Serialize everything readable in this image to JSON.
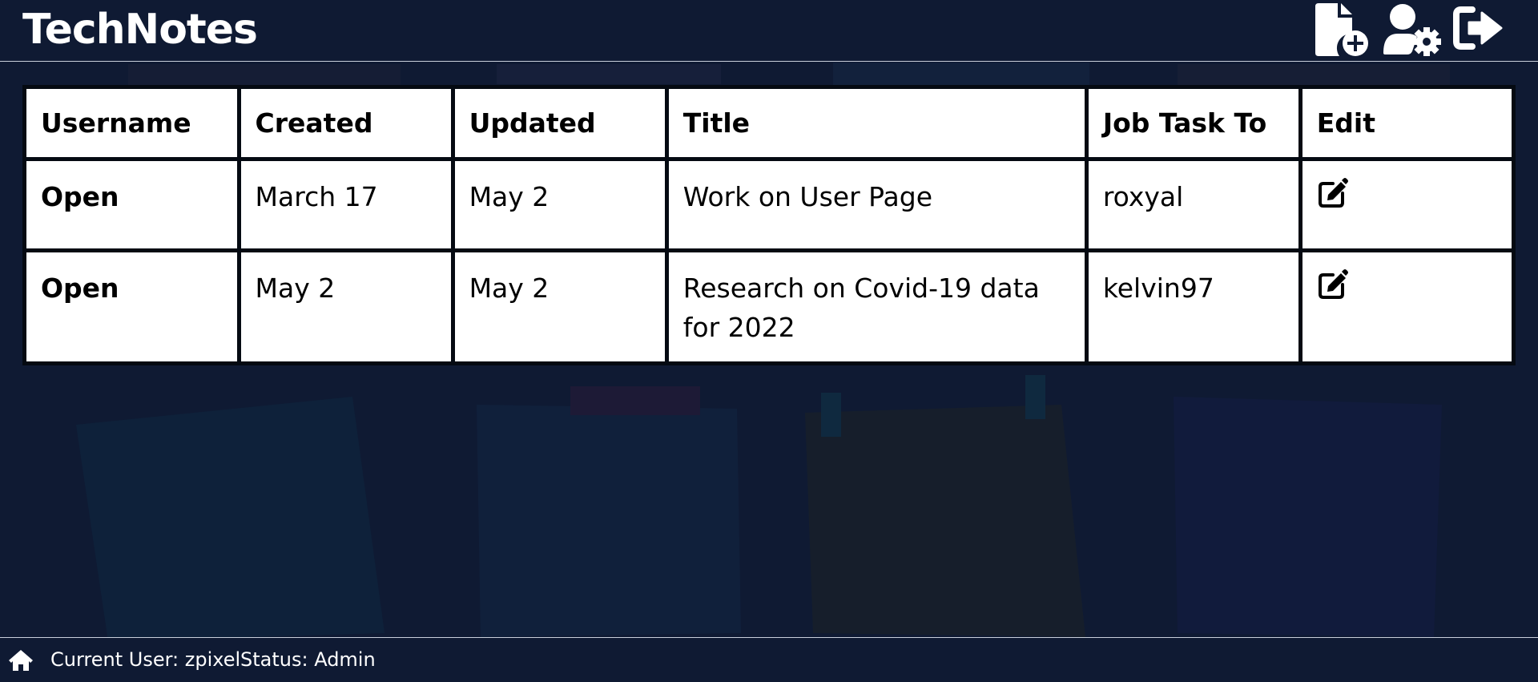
{
  "header": {
    "app_title": "TechNotes",
    "actions": [
      {
        "icon": "new-note-icon",
        "label": ""
      },
      {
        "icon": "user-settings-icon",
        "label": ""
      },
      {
        "icon": "logout-icon",
        "label": ""
      }
    ]
  },
  "table": {
    "columns": [
      "Username",
      "Created",
      "Updated",
      "Title",
      "Job Task To",
      "Edit"
    ],
    "rows": [
      {
        "status": "Open",
        "created": "March 17",
        "updated": "May 2",
        "title": "Work on User Page",
        "assignee": "roxyal",
        "edit_icon": "edit-icon"
      },
      {
        "status": "Open",
        "created": "May 2",
        "updated": "May 2",
        "title": "Research on Covid-19 data for 2022",
        "assignee": "kelvin97",
        "edit_icon": "edit-icon"
      }
    ]
  },
  "footer": {
    "home_icon": "home-icon",
    "current_user": "Current User: zpixel",
    "status": "Status: Admin"
  },
  "colors": {
    "background": "#0f1a33",
    "status_open": "#a62626",
    "cell_background": "#ffffff"
  }
}
